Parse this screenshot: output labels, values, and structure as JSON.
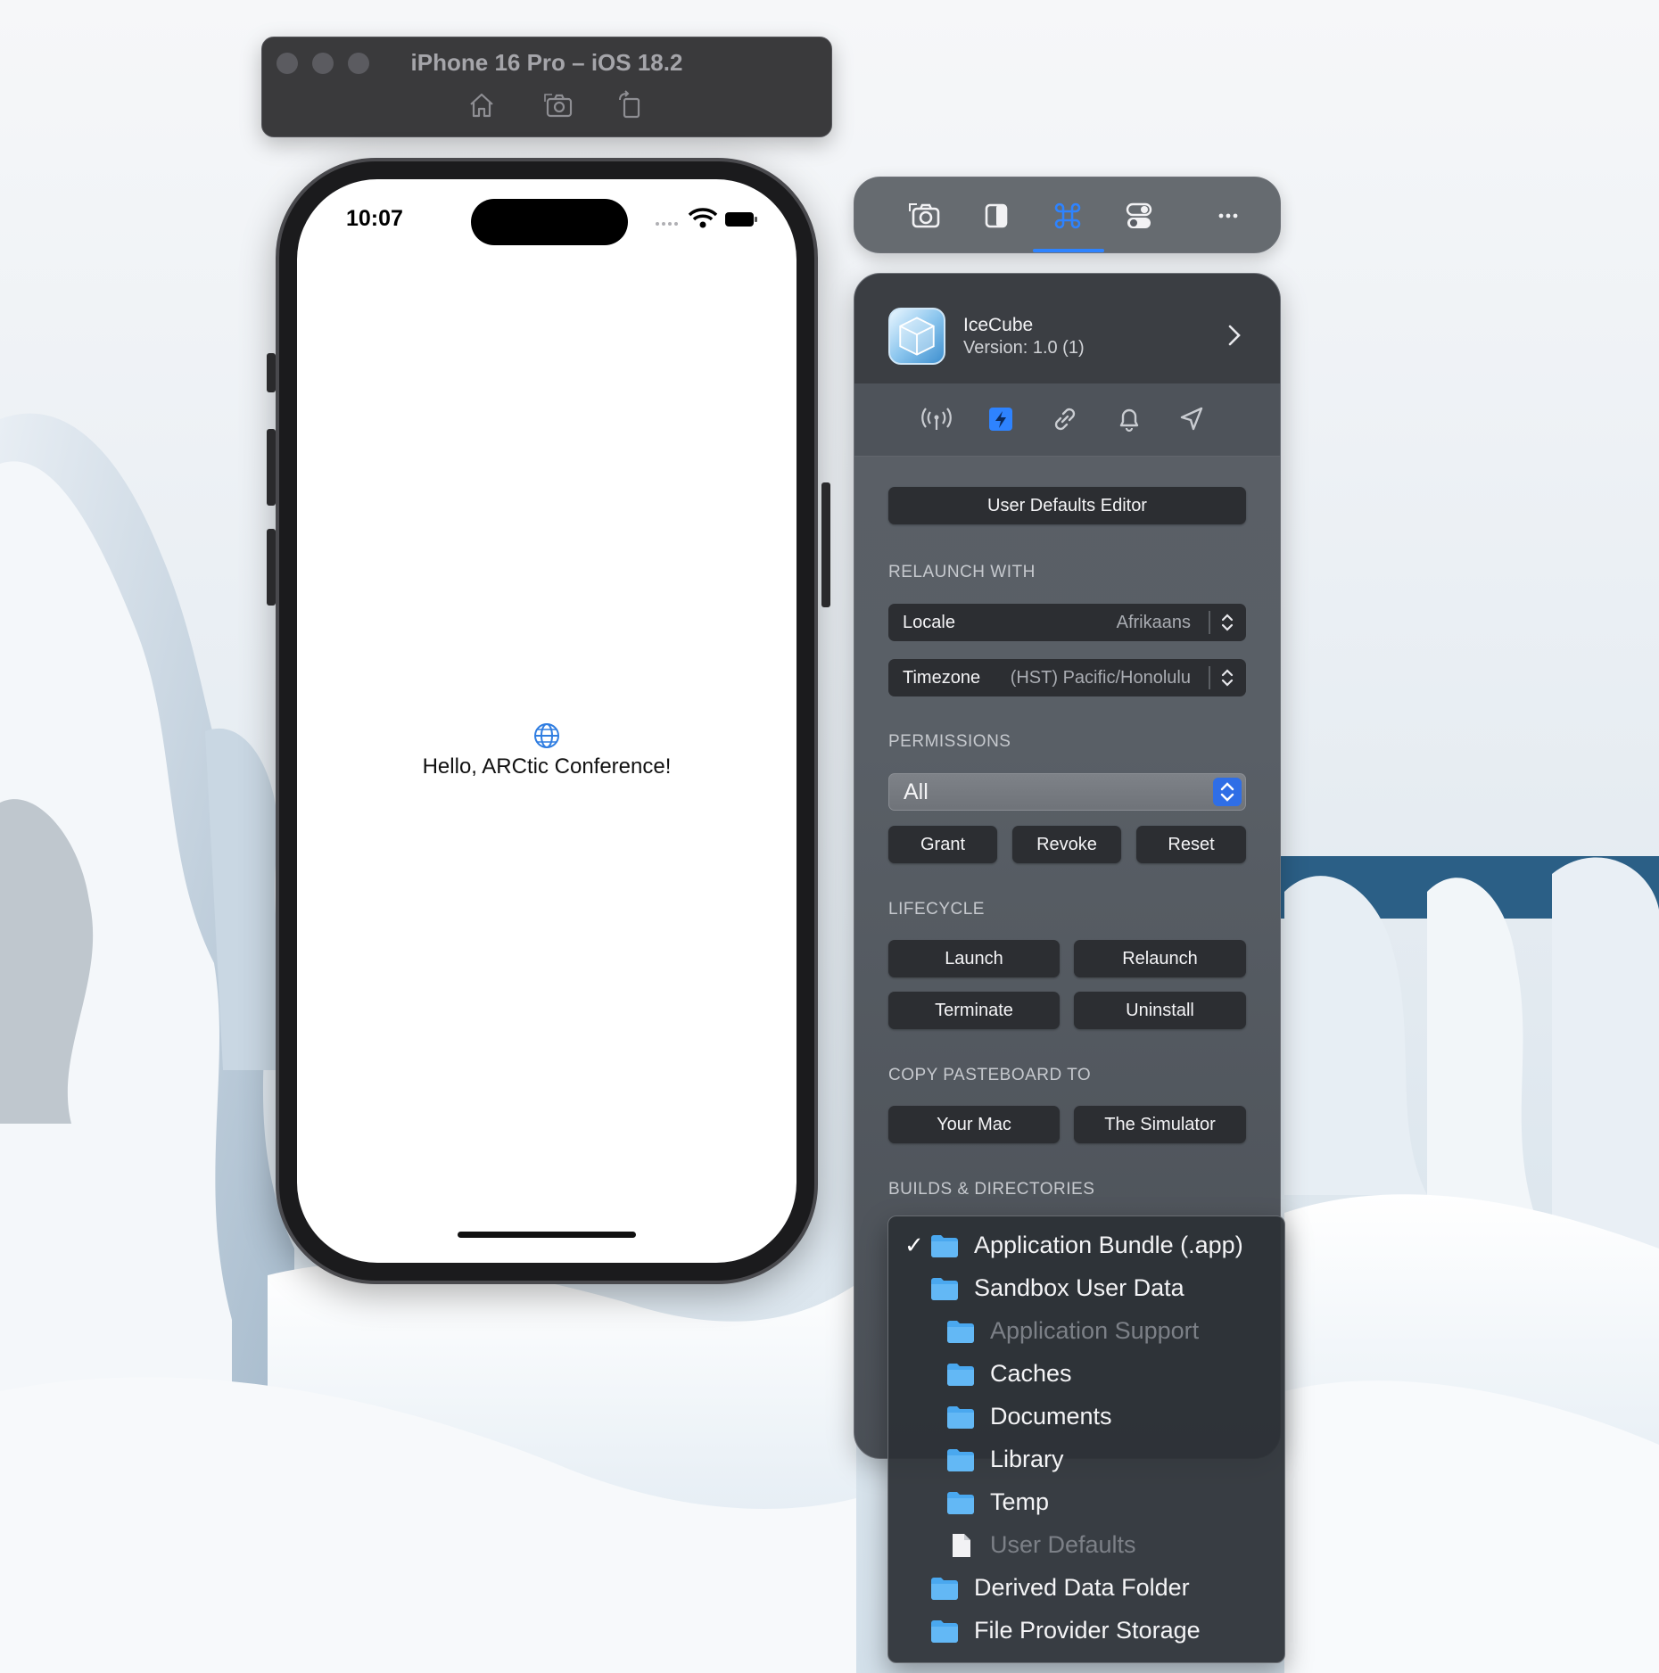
{
  "simulator": {
    "title": "iPhone 16 Pro – iOS 18.2",
    "toolbar_icons": [
      "home-icon",
      "screenshot-icon",
      "rotate-icon"
    ],
    "status_time": "10:07",
    "screen_text": "Hello, ARCtic Conference!"
  },
  "icecube": {
    "toolbar_icons": [
      "camera-icon",
      "sidebar-icon",
      "command-icon",
      "toggles-icon",
      "more-icon"
    ],
    "active_toolbar_icon": "command-icon",
    "app_name": "IceCube",
    "app_version": "Version: 1.0 (1)",
    "icon_row": [
      "antenna-icon",
      "bolt-icon",
      "link-icon",
      "bell-icon",
      "location-icon"
    ],
    "active_icon_row": "bolt-icon",
    "user_defaults_button": "User Defaults Editor",
    "relaunch_with_label": "RELAUNCH WITH",
    "locale": {
      "label": "Locale",
      "value": "Afrikaans"
    },
    "timezone": {
      "label": "Timezone",
      "value": "(HST) Pacific/Honolulu"
    },
    "permissions_label": "PERMISSIONS",
    "permissions_value": "All",
    "permission_buttons": {
      "grant": "Grant",
      "revoke": "Revoke",
      "reset": "Reset"
    },
    "lifecycle_label": "LIFECYCLE",
    "lifecycle_buttons": {
      "launch": "Launch",
      "relaunch": "Relaunch",
      "terminate": "Terminate",
      "uninstall": "Uninstall"
    },
    "pasteboard_label": "COPY PASTEBOARD TO",
    "pasteboard_buttons": {
      "mac": "Your Mac",
      "simulator": "The Simulator"
    },
    "builds_label": "BUILDS & DIRECTORIES"
  },
  "dropdown": {
    "items": [
      {
        "label": "Application Bundle (.app)",
        "checked": true,
        "indent": 0,
        "icon": "folder-icon",
        "disabled": false
      },
      {
        "label": "Sandbox User Data",
        "checked": false,
        "indent": 0,
        "icon": "folder-icon",
        "disabled": false
      },
      {
        "label": "Application Support",
        "checked": false,
        "indent": 1,
        "icon": "folder-icon",
        "disabled": true
      },
      {
        "label": "Caches",
        "checked": false,
        "indent": 1,
        "icon": "folder-icon",
        "disabled": false
      },
      {
        "label": "Documents",
        "checked": false,
        "indent": 1,
        "icon": "folder-icon",
        "disabled": false
      },
      {
        "label": "Library",
        "checked": false,
        "indent": 1,
        "icon": "folder-icon",
        "disabled": false
      },
      {
        "label": "Temp",
        "checked": false,
        "indent": 1,
        "icon": "folder-icon",
        "disabled": false
      },
      {
        "label": "User Defaults",
        "checked": false,
        "indent": 1,
        "icon": "document-icon",
        "disabled": true
      },
      {
        "label": "Derived Data Folder",
        "checked": false,
        "indent": 0,
        "icon": "folder-icon",
        "disabled": false
      },
      {
        "label": "File Provider Storage",
        "checked": false,
        "indent": 0,
        "icon": "folder-icon",
        "disabled": false
      }
    ]
  },
  "colors": {
    "accent": "#2e83ff",
    "folder": "#4aa8ef",
    "panel": "#585d64"
  }
}
